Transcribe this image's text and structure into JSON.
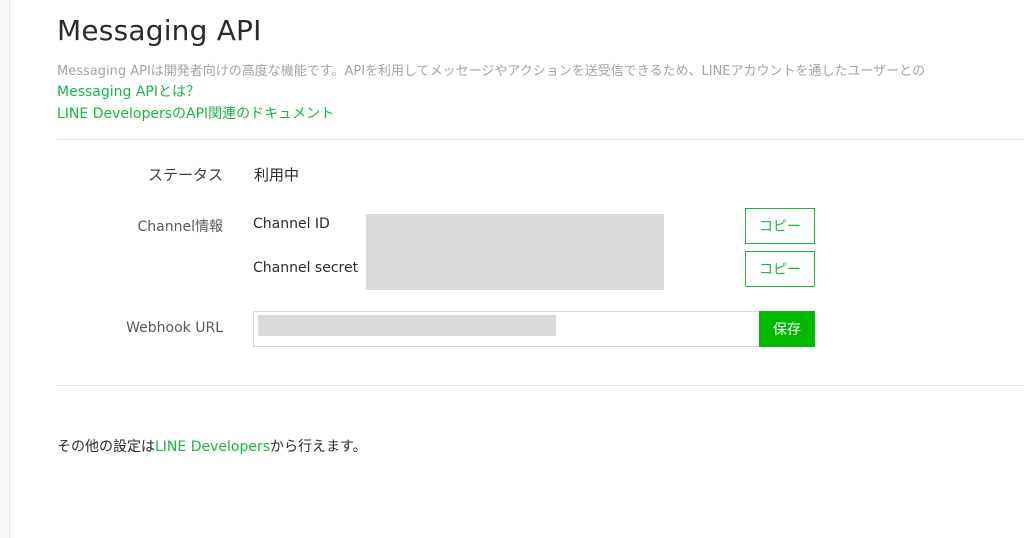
{
  "header": {
    "title": "Messaging API",
    "description": "Messaging APIは開発者向けの高度な機能です。APIを利用してメッセージやアクションを送受信できるため、LINEアカウントを通したユーザーとの",
    "link_what_is": "Messaging APIとは？",
    "link_docs": "LINE DevelopersのAPI関連のドキュメント"
  },
  "settings": {
    "status_label": "ステータス",
    "status_value": "利用中",
    "channel_label": "Channel情報",
    "channel_id_key": "Channel ID",
    "channel_secret_key": "Channel secret",
    "copy_label": "コピー",
    "webhook_label": "Webhook URL",
    "webhook_value": "",
    "save_label": "保存"
  },
  "footer": {
    "prefix": "その他の設定は",
    "link": "LINE Developers",
    "suffix": "から行えます。"
  },
  "colors": {
    "accent": "#00b900",
    "link": "#1db446",
    "redaction": "#d9d9d9"
  }
}
